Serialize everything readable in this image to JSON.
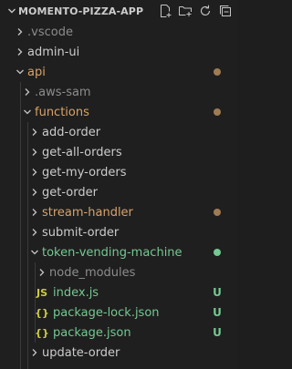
{
  "explorer": {
    "title": "MOMENTO-PIZZA-APP",
    "actions": [
      {
        "name": "new-file-icon"
      },
      {
        "name": "new-folder-icon"
      },
      {
        "name": "refresh-icon"
      },
      {
        "name": "collapse-all-icon"
      }
    ]
  },
  "colors": {
    "background": "#1f1f1f",
    "modified": "#d7a36a",
    "untracked": "#73c991",
    "ignored": "#8c8c8c",
    "json_icon": "#cbcb41",
    "js_icon": "#cbcb41"
  },
  "tree": [
    {
      "label": ".vscode",
      "depth": 1,
      "type": "folder",
      "expanded": false,
      "status": "ignored"
    },
    {
      "label": "admin-ui",
      "depth": 1,
      "type": "folder",
      "expanded": false,
      "status": "normal"
    },
    {
      "label": "api",
      "depth": 1,
      "type": "folder",
      "expanded": true,
      "status": "modified",
      "dot": true
    },
    {
      "label": ".aws-sam",
      "depth": 2,
      "type": "folder",
      "expanded": false,
      "status": "ignored"
    },
    {
      "label": "functions",
      "depth": 2,
      "type": "folder",
      "expanded": true,
      "status": "modified",
      "dot": true
    },
    {
      "label": "add-order",
      "depth": 3,
      "type": "folder",
      "expanded": false,
      "status": "normal"
    },
    {
      "label": "get-all-orders",
      "depth": 3,
      "type": "folder",
      "expanded": false,
      "status": "normal"
    },
    {
      "label": "get-my-orders",
      "depth": 3,
      "type": "folder",
      "expanded": false,
      "status": "normal"
    },
    {
      "label": "get-order",
      "depth": 3,
      "type": "folder",
      "expanded": false,
      "status": "normal"
    },
    {
      "label": "stream-handler",
      "depth": 3,
      "type": "folder",
      "expanded": false,
      "status": "modified",
      "dot": true
    },
    {
      "label": "submit-order",
      "depth": 3,
      "type": "folder",
      "expanded": false,
      "status": "normal"
    },
    {
      "label": "token-vending-machine",
      "depth": 3,
      "type": "folder",
      "expanded": true,
      "status": "untracked",
      "dot": true
    },
    {
      "label": "node_modules",
      "depth": 4,
      "type": "folder",
      "expanded": false,
      "status": "ignored"
    },
    {
      "label": "index.js",
      "depth": 4,
      "type": "js",
      "status": "untracked",
      "badge": "U",
      "icon_text": "JS"
    },
    {
      "label": "package-lock.json",
      "depth": 4,
      "type": "json",
      "status": "untracked",
      "badge": "U",
      "icon_text": "{}"
    },
    {
      "label": "package.json",
      "depth": 4,
      "type": "json",
      "status": "untracked",
      "badge": "U",
      "icon_text": "{}"
    },
    {
      "label": "update-order",
      "depth": 3,
      "type": "folder",
      "expanded": false,
      "status": "normal"
    },
    {
      "label": "",
      "depth": 3,
      "type": "folder",
      "expanded": false,
      "status": "normal"
    }
  ]
}
